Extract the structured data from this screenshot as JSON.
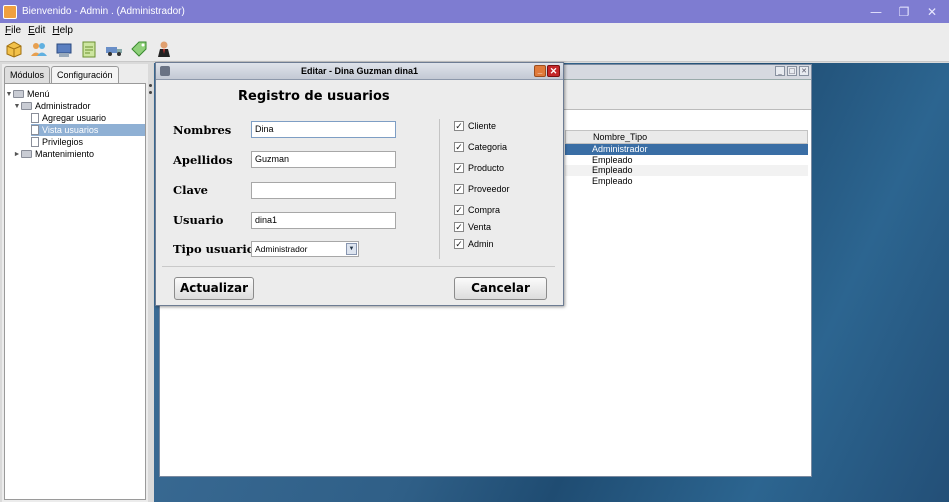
{
  "window": {
    "title": "Bienvenido - Admin . (Administrador)"
  },
  "menu": {
    "file": "File",
    "edit": "Edit",
    "help": "Help"
  },
  "tabs": [
    {
      "label": "Módulos"
    },
    {
      "label": "Configuración"
    }
  ],
  "tree": {
    "root": "Menú",
    "admin": "Administrador",
    "add_user": "Agregar usuario",
    "view_users": "Vista usuarios",
    "privileges": "Privilegios",
    "maintenance": "Mantenimiento"
  },
  "table": {
    "header": "Nombre_Tipo",
    "rows": [
      "Administrador",
      "Empleado",
      "Empleado",
      "Empleado"
    ]
  },
  "dialog": {
    "title": "Editar - Dina Guzman dina1",
    "heading": "Registro de usuarios",
    "nombres_label": "Nombres",
    "nombres_value": "Dina",
    "apellidos_label": "Apellidos",
    "apellidos_value": "Guzman",
    "clave_label": "Clave",
    "clave_value": "",
    "usuario_label": "Usuario",
    "usuario_value": "dina1",
    "tipo_label": "Tipo usuario",
    "tipo_value": "Administrador",
    "permissions": [
      {
        "label": "Cliente",
        "checked": true
      },
      {
        "label": "Categoria",
        "checked": true
      },
      {
        "label": "Producto",
        "checked": true
      },
      {
        "label": "Proveedor",
        "checked": true
      },
      {
        "label": "Compra",
        "checked": true
      },
      {
        "label": "Venta",
        "checked": true
      },
      {
        "label": "Admin",
        "checked": true
      }
    ],
    "update_label": "Actualizar",
    "cancel_label": "Cancelar"
  }
}
